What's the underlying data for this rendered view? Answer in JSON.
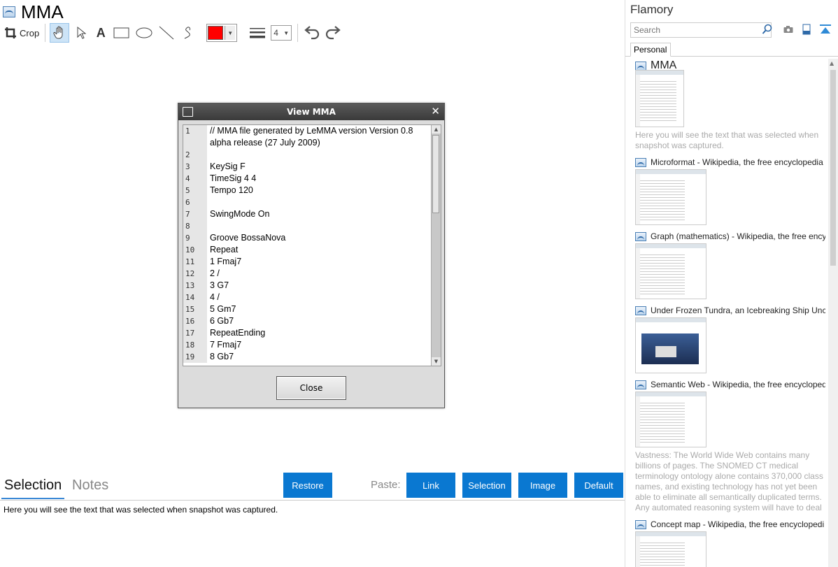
{
  "document": {
    "title": "MMA"
  },
  "toolbar": {
    "crop_label": "Crop",
    "line_width": "4",
    "color": "#ff0000"
  },
  "dialog": {
    "title": "View MMA",
    "close_label": "Close",
    "lines": [
      {
        "n": "1",
        "text": "// MMA file generated by LeMMA version Version 0.8 alpha release (27 July 2009)"
      },
      {
        "n": "2",
        "text": ""
      },
      {
        "n": "3",
        "text": "KeySig F"
      },
      {
        "n": "4",
        "text": "TimeSig 4 4"
      },
      {
        "n": "5",
        "text": "Tempo 120"
      },
      {
        "n": "6",
        "text": ""
      },
      {
        "n": "7",
        "text": "SwingMode On"
      },
      {
        "n": "8",
        "text": ""
      },
      {
        "n": "9",
        "text": "Groove BossaNova"
      },
      {
        "n": "10",
        "text": "Repeat"
      },
      {
        "n": "11",
        "text": "1 Fmaj7"
      },
      {
        "n": "12",
        "text": "2 /"
      },
      {
        "n": "13",
        "text": "3 G7"
      },
      {
        "n": "14",
        "text": "4 /"
      },
      {
        "n": "15",
        "text": "5 Gm7"
      },
      {
        "n": "16",
        "text": "6 Gb7"
      },
      {
        "n": "17",
        "text": "RepeatEnding"
      },
      {
        "n": "18",
        "text": "7 Fmaj7"
      },
      {
        "n": "19",
        "text": "8 Gb7"
      }
    ]
  },
  "bottom": {
    "tab_selection": "Selection",
    "tab_notes": "Notes",
    "restore": "Restore",
    "paste_label": "Paste:",
    "link": "Link",
    "selection": "Selection",
    "image": "Image",
    "default": "Default",
    "selection_text": "Here you will see the text that was selected when snapshot was captured."
  },
  "sidebar": {
    "title": "Flamory",
    "search_placeholder": "Search",
    "tab": "Personal",
    "items": [
      {
        "title": "MMA",
        "desc": "Here you will see the text that was selected when snapshot was captured."
      },
      {
        "title": "Microformat - Wikipedia, the free encyclopedia",
        "desc": ""
      },
      {
        "title": "Graph (mathematics) - Wikipedia, the free ency",
        "desc": ""
      },
      {
        "title": "Under Frozen Tundra, an Icebreaking Ship Unco",
        "desc": ""
      },
      {
        "title": "Semantic Web - Wikipedia, the free encycloped",
        "desc": "Vastness: The World Wide Web contains many billions of pages. The SNOMED CT medical terminology ontology alone contains 370,000 class names, and existing technology has not yet been able to eliminate all semantically duplicated terms. Any automated reasoning system will have to deal with truly huge inputs."
      },
      {
        "title": "Concept map - Wikipedia, the free encyclopedi",
        "desc": ""
      }
    ]
  }
}
